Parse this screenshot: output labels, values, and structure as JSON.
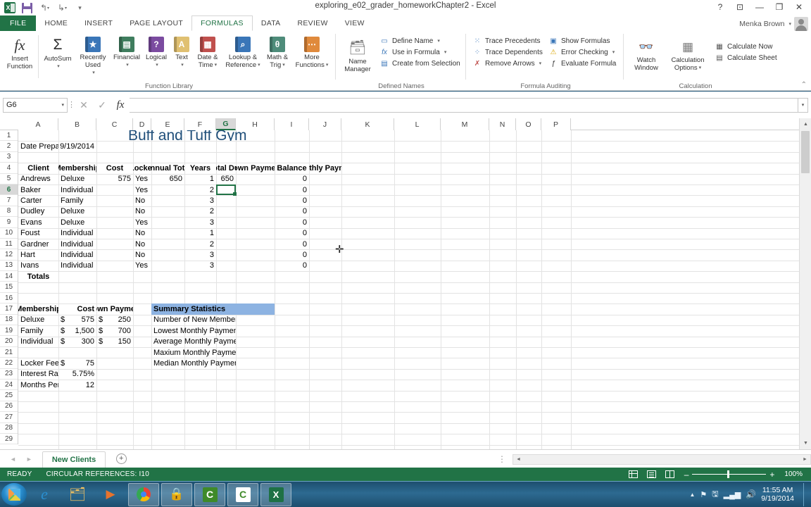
{
  "window": {
    "title": "exploring_e02_grader_homeworkChapter2 - Excel",
    "account_name": "Menka Brown",
    "quick_access": [
      "save-icon",
      "undo-icon",
      "redo-icon",
      "customize-icon"
    ],
    "controls": {
      "help": "?",
      "ribbon_display": "⊡",
      "minimize": "—",
      "restore": "❐",
      "close": "✕"
    }
  },
  "ribbon": {
    "tabs": [
      {
        "label": "FILE",
        "active": false
      },
      {
        "label": "HOME",
        "active": false
      },
      {
        "label": "INSERT",
        "active": false
      },
      {
        "label": "PAGE LAYOUT",
        "active": false
      },
      {
        "label": "FORMULAS",
        "active": true
      },
      {
        "label": "DATA",
        "active": false
      },
      {
        "label": "REVIEW",
        "active": false
      },
      {
        "label": "VIEW",
        "active": false
      }
    ],
    "groups": {
      "function_library": {
        "name": "Function Library",
        "insert_function": "Insert\nFunction",
        "buttons": [
          {
            "l1": "Insert",
            "l2": "Function"
          },
          {
            "l1": "AutoSum",
            "l2": "",
            "dd": true
          },
          {
            "l1": "Recently",
            "l2": "Used",
            "dd": true
          },
          {
            "l1": "Financial",
            "l2": "",
            "dd": true
          },
          {
            "l1": "Logical",
            "l2": "",
            "dd": true
          },
          {
            "l1": "Text",
            "l2": "",
            "dd": true
          },
          {
            "l1": "Date &",
            "l2": "Time",
            "dd": true
          },
          {
            "l1": "Lookup &",
            "l2": "Reference",
            "dd": true
          },
          {
            "l1": "Math &",
            "l2": "Trig",
            "dd": true
          },
          {
            "l1": "More",
            "l2": "Functions",
            "dd": true
          }
        ]
      },
      "defined_names": {
        "name": "Defined Names",
        "name_manager_l1": "Name",
        "name_manager_l2": "Manager",
        "items": [
          "Define Name",
          "Use in Formula",
          "Create from Selection"
        ]
      },
      "formula_auditing": {
        "name": "Formula Auditing",
        "col1": [
          "Trace Precedents",
          "Trace Dependents",
          "Remove Arrows"
        ],
        "col2": [
          "Show Formulas",
          "Error Checking",
          "Evaluate Formula"
        ]
      },
      "calculation": {
        "name": "Calculation",
        "watch_l1": "Watch",
        "watch_l2": "Window",
        "options_l1": "Calculation",
        "options_l2": "Options",
        "items": [
          "Calculate Now",
          "Calculate Sheet"
        ]
      }
    }
  },
  "formula_bar": {
    "name_box": "G6",
    "formula": "",
    "cancel_icon": "✕",
    "enter_icon": "✓",
    "fx_icon": "fx"
  },
  "grid": {
    "columns": [
      "A",
      "B",
      "C",
      "D",
      "E",
      "F",
      "G",
      "H",
      "I",
      "J",
      "K",
      "L",
      "M",
      "N",
      "O",
      "P"
    ],
    "selected_column": "G",
    "selected_row": 6,
    "selected_cell": "G6",
    "rows": [
      1,
      2,
      3,
      4,
      5,
      6,
      7,
      8,
      9,
      10,
      11,
      12,
      13,
      14,
      15,
      16,
      17,
      18,
      19,
      20,
      21,
      22,
      23,
      24,
      25,
      26,
      27,
      28,
      29
    ],
    "title": "Buff and Tuff Gym",
    "date_prepared_label": "Date Prepared:",
    "date_prepared_value": "9/19/2014",
    "table_headers": [
      "Client",
      "Membership",
      "Cost",
      "Locker",
      "Annual Total",
      "Years",
      "Total Due",
      "Down Payment",
      "Balance",
      "Monthly Payment"
    ],
    "table_rows": [
      {
        "row": 5,
        "client": "Andrews",
        "membership": "Deluxe",
        "cost": "575",
        "locker": "Yes",
        "annual_total": "650",
        "years": "1",
        "total_due": "650",
        "down_payment": "",
        "balance": "0",
        "monthly_payment": ""
      },
      {
        "row": 6,
        "client": "Baker",
        "membership": "Individual",
        "cost": "",
        "locker": "Yes",
        "annual_total": "",
        "years": "2",
        "total_due": "",
        "down_payment": "",
        "balance": "0",
        "monthly_payment": ""
      },
      {
        "row": 7,
        "client": "Carter",
        "membership": "Family",
        "cost": "",
        "locker": "No",
        "annual_total": "",
        "years": "3",
        "total_due": "",
        "down_payment": "",
        "balance": "0",
        "monthly_payment": ""
      },
      {
        "row": 8,
        "client": "Dudley",
        "membership": "Deluxe",
        "cost": "",
        "locker": "No",
        "annual_total": "",
        "years": "2",
        "total_due": "",
        "down_payment": "",
        "balance": "0",
        "monthly_payment": ""
      },
      {
        "row": 9,
        "client": "Evans",
        "membership": "Deluxe",
        "cost": "",
        "locker": "Yes",
        "annual_total": "",
        "years": "3",
        "total_due": "",
        "down_payment": "",
        "balance": "0",
        "monthly_payment": ""
      },
      {
        "row": 10,
        "client": "Foust",
        "membership": "Individual",
        "cost": "",
        "locker": "No",
        "annual_total": "",
        "years": "1",
        "total_due": "",
        "down_payment": "",
        "balance": "0",
        "monthly_payment": ""
      },
      {
        "row": 11,
        "client": "Gardner",
        "membership": "Individual",
        "cost": "",
        "locker": "No",
        "annual_total": "",
        "years": "2",
        "total_due": "",
        "down_payment": "",
        "balance": "0",
        "monthly_payment": ""
      },
      {
        "row": 12,
        "client": "Hart",
        "membership": "Individual",
        "cost": "",
        "locker": "No",
        "annual_total": "",
        "years": "3",
        "total_due": "",
        "down_payment": "",
        "balance": "0",
        "monthly_payment": ""
      },
      {
        "row": 13,
        "client": "Ivans",
        "membership": "Individual",
        "cost": "",
        "locker": "Yes",
        "annual_total": "",
        "years": "3",
        "total_due": "",
        "down_payment": "",
        "balance": "0",
        "monthly_payment": ""
      }
    ],
    "totals_label": "Totals",
    "lookup_table": {
      "headers": [
        "Membership",
        "Cost",
        "Down Payment"
      ],
      "rows": [
        {
          "row": 18,
          "membership": "Deluxe",
          "cost_sym": "$",
          "cost": "575",
          "dp_sym": "$",
          "down_payment": "250"
        },
        {
          "row": 19,
          "membership": "Family",
          "cost_sym": "$",
          "cost": "1,500",
          "dp_sym": "$",
          "down_payment": "700"
        },
        {
          "row": 20,
          "membership": "Individual",
          "cost_sym": "$",
          "cost": "300",
          "dp_sym": "$",
          "down_payment": "150"
        }
      ],
      "extras": [
        {
          "row": 22,
          "label": "Locker Fee",
          "sym": "$",
          "value": "75"
        },
        {
          "row": 23,
          "label": "Interest Rate",
          "sym": "",
          "value": "5.75%"
        },
        {
          "row": 24,
          "label": "Months Per Year",
          "sym": "",
          "value": "12"
        }
      ]
    },
    "summary": {
      "header": "Summary Statistics",
      "header_fill": "#8db3e2",
      "items": [
        {
          "row": 18,
          "label": "Number of New Members"
        },
        {
          "row": 19,
          "label": "Lowest Monthly Payment"
        },
        {
          "row": 20,
          "label": "Average Monthly Payment"
        },
        {
          "row": 21,
          "label": "Maxium Monthly Payment"
        },
        {
          "row": 22,
          "label": "Median Monthly Payment"
        }
      ]
    }
  },
  "sheet_tabs": {
    "tabs": [
      {
        "label": "New Clients",
        "active": true
      }
    ],
    "add_label": "+",
    "prev_icon": "◄",
    "next_icon": "►"
  },
  "status_bar": {
    "state": "READY",
    "message": "CIRCULAR REFERENCES: I10",
    "views": [
      "normal-view-icon",
      "page-layout-icon",
      "page-break-icon"
    ],
    "zoom_out": "–",
    "zoom_in": "+",
    "zoom_level": "100%"
  },
  "taskbar": {
    "start": "start-orb",
    "apps": [
      {
        "name": "internet-explorer",
        "glyph": "e",
        "running": false
      },
      {
        "name": "file-explorer",
        "glyph": "",
        "running": false
      },
      {
        "name": "media-player",
        "glyph": "▶",
        "running": false
      },
      {
        "name": "google-chrome",
        "glyph": "",
        "running": true
      },
      {
        "name": "security-app",
        "glyph": "",
        "running": true
      },
      {
        "name": "camtasia-studio",
        "glyph": "C",
        "running": true
      },
      {
        "name": "camtasia-recorder",
        "glyph": "C",
        "running": true
      },
      {
        "name": "excel",
        "glyph": "X",
        "running": true
      }
    ],
    "tray": [
      "show-hidden-icon",
      "flag-icon",
      "action-center-icon",
      "network-icon",
      "volume-icon"
    ],
    "clock_time": "11:55 AM",
    "clock_date": "9/19/2014"
  }
}
